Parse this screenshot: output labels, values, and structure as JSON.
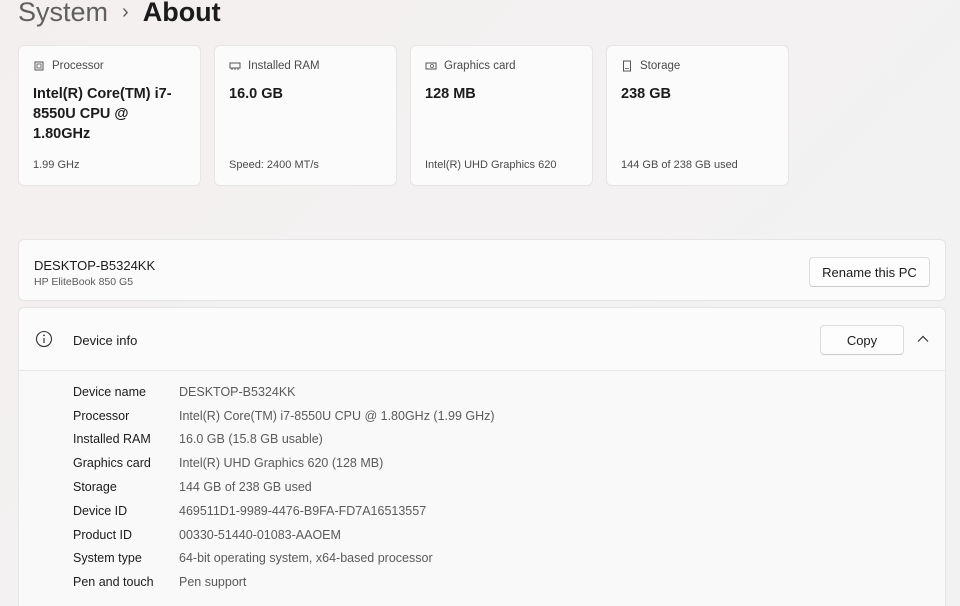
{
  "breadcrumb": {
    "parent": "System",
    "separator": "›",
    "current": "About"
  },
  "cards": [
    {
      "icon": "processor-icon",
      "title": "Processor",
      "value": "Intel(R) Core(TM) i7-8550U CPU @ 1.80GHz",
      "sub": "1.99 GHz"
    },
    {
      "icon": "ram-icon",
      "title": "Installed RAM",
      "value": "16.0 GB",
      "sub": "Speed: 2400 MT/s"
    },
    {
      "icon": "graphics-card-icon",
      "title": "Graphics card",
      "value": "128 MB",
      "sub": "Intel(R) UHD Graphics 620"
    },
    {
      "icon": "storage-icon",
      "title": "Storage",
      "value": "238 GB",
      "sub": "144 GB of 238 GB used"
    }
  ],
  "pc": {
    "name": "DESKTOP-B5324KK",
    "model": "HP EliteBook 850 G5",
    "rename_label": "Rename this PC"
  },
  "device_info": {
    "title": "Device info",
    "copy_label": "Copy",
    "rows": [
      {
        "label": "Device name",
        "value": "DESKTOP-B5324KK"
      },
      {
        "label": "Processor",
        "value": "Intel(R) Core(TM) i7-8550U CPU @ 1.80GHz (1.99 GHz)"
      },
      {
        "label": "Installed RAM",
        "value": "16.0 GB (15.8 GB usable)"
      },
      {
        "label": "Graphics card",
        "value": "Intel(R) UHD Graphics 620 (128 MB)"
      },
      {
        "label": "Storage",
        "value": "144 GB of 238 GB used"
      },
      {
        "label": "Device ID",
        "value": "469511D1-9989-4476-B9FA-FD7A16513557"
      },
      {
        "label": "Product ID",
        "value": "00330-51440-01083-AAOEM"
      },
      {
        "label": "System type",
        "value": "64-bit operating system, x64-based processor"
      },
      {
        "label": "Pen and touch",
        "value": "Pen support"
      }
    ]
  }
}
